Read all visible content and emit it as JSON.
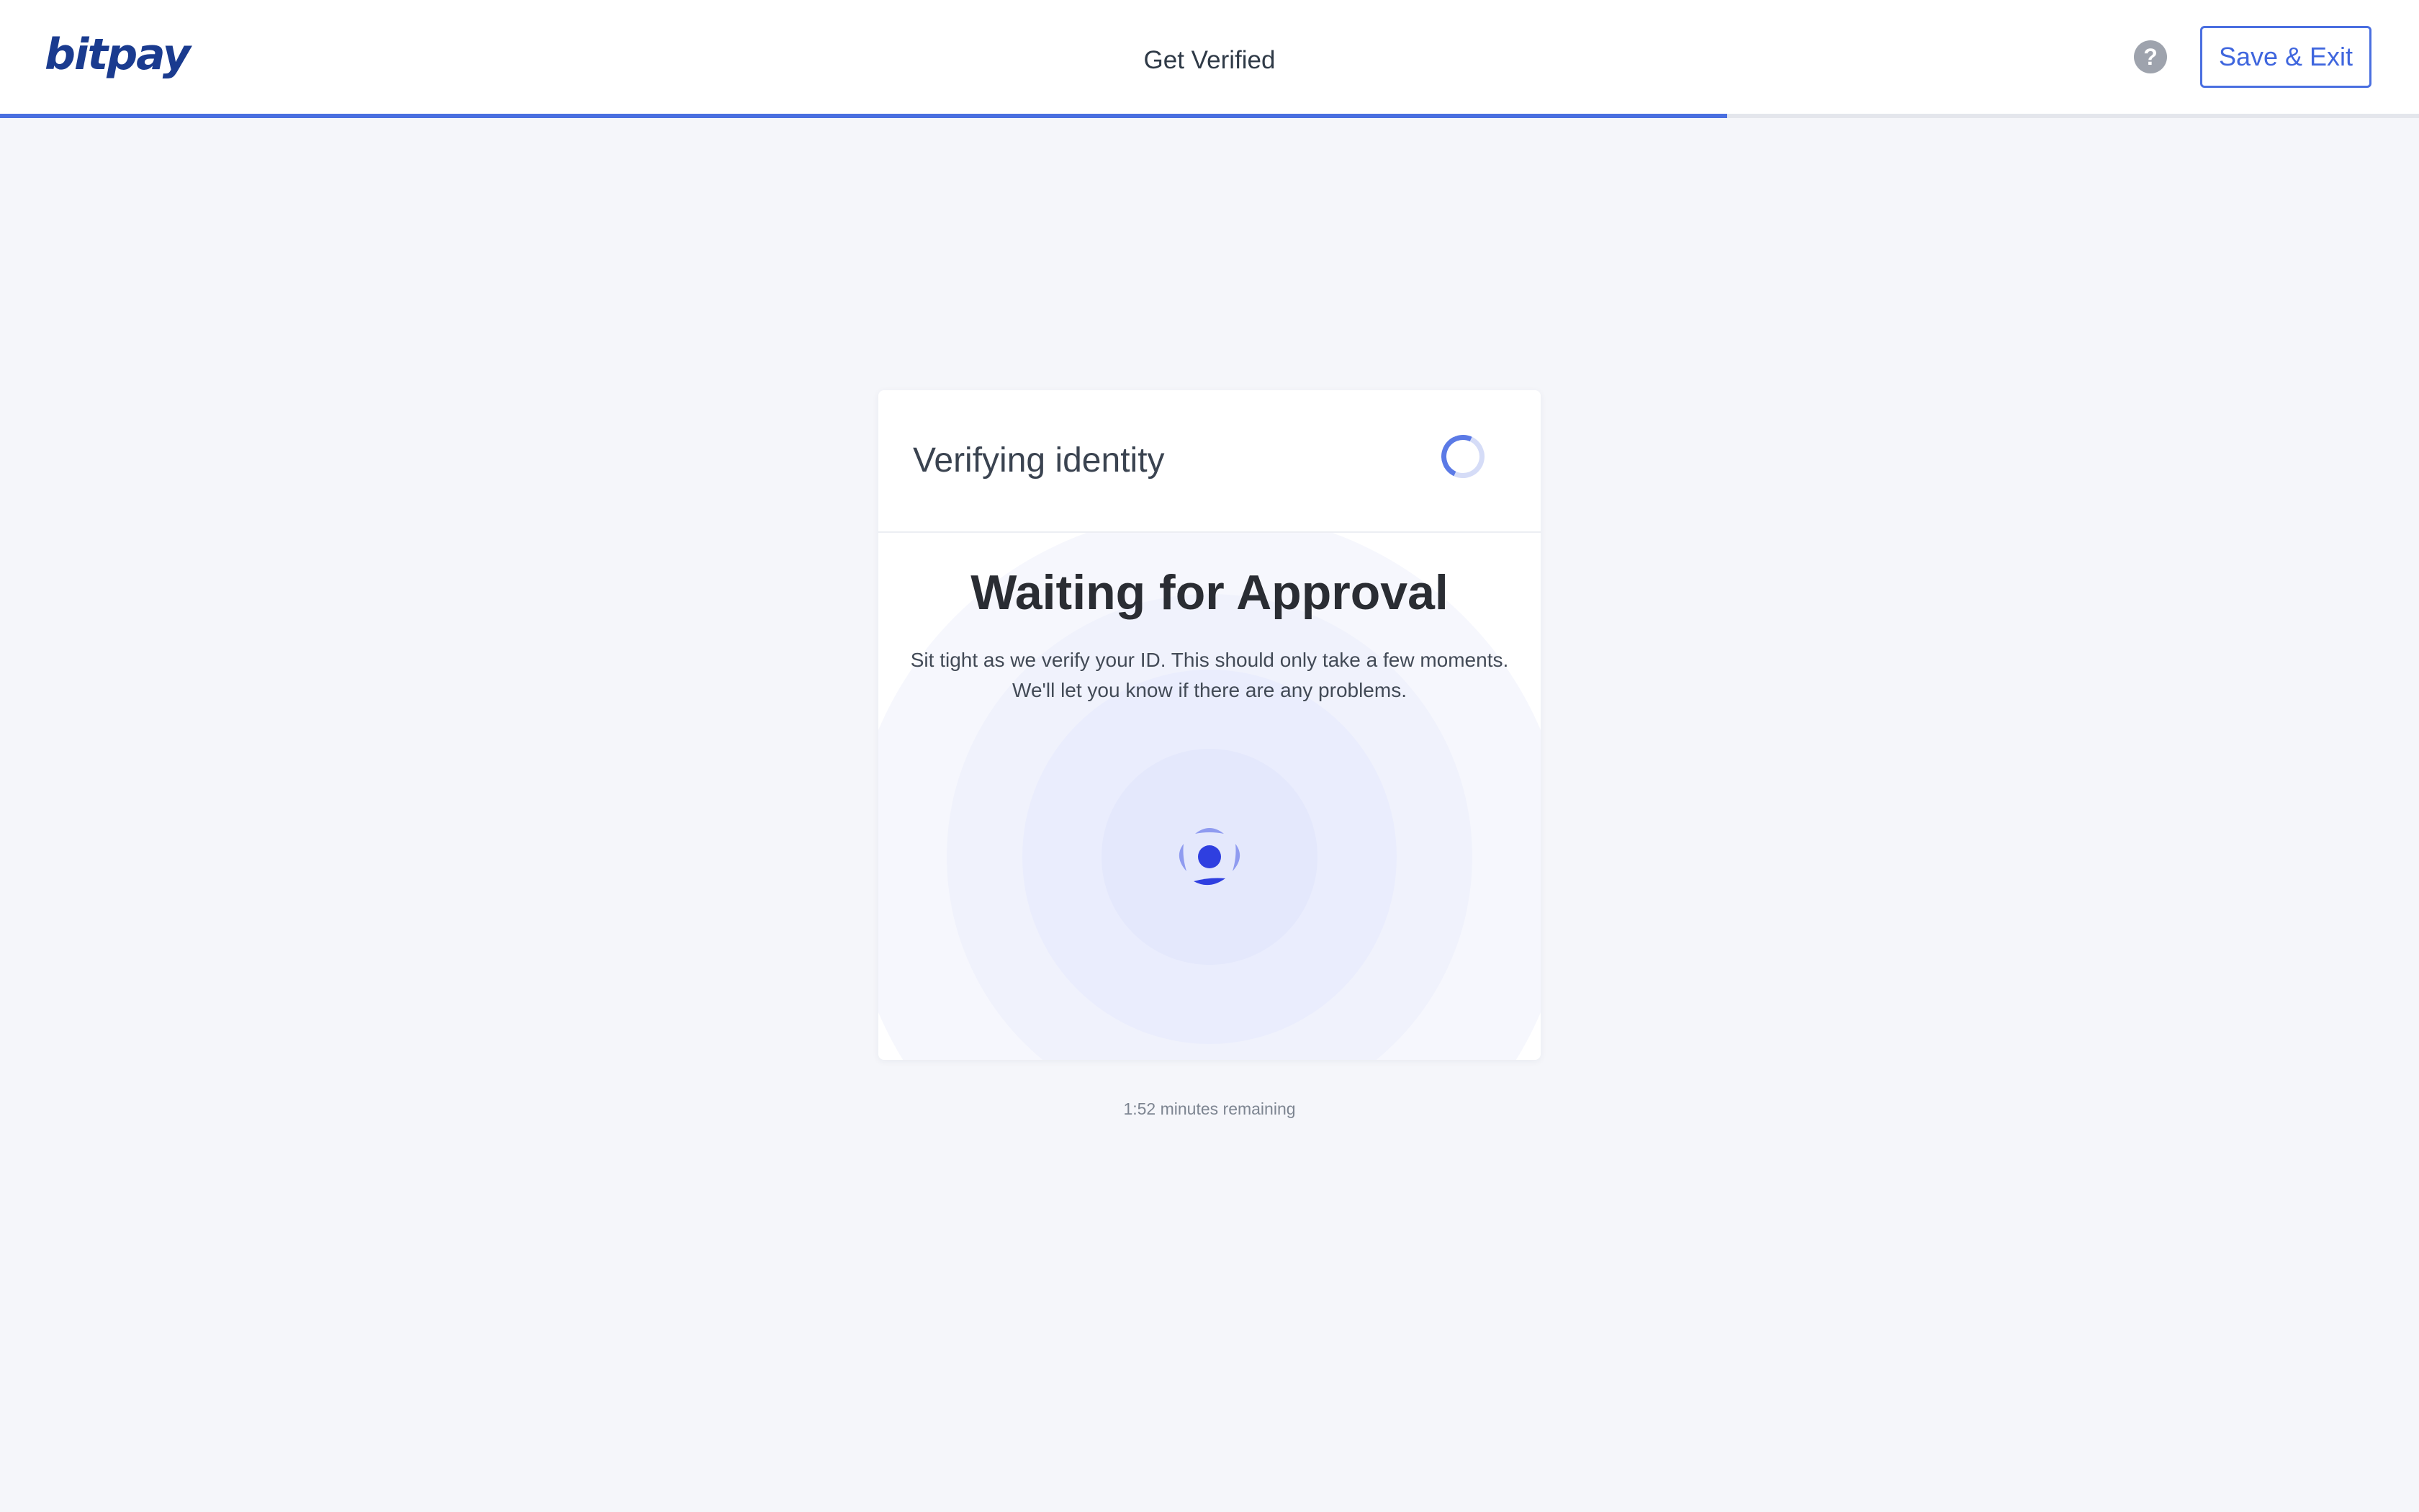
{
  "header": {
    "logo_text": "bitpay",
    "title": "Get Verified",
    "help_icon": "help-circle-icon",
    "help_symbol": "?",
    "save_exit_label": "Save & Exit",
    "progress_fraction": 0.714
  },
  "card": {
    "title": "Verifying identity",
    "status_icon": "loading-spinner-icon",
    "heading": "Waiting for Approval",
    "message_line1": "Sit tight as we verify your ID. This should only take a few moments.",
    "message_line2": "We'll let you know if there are any problems.",
    "center_icon": "identity-scan-icon"
  },
  "footer": {
    "timer_text": "1:52 minutes remaining"
  },
  "colors": {
    "accent": "#4a6fe0",
    "logo": "#1a3b8f",
    "background": "#f5f6fa",
    "icon_primary": "#2f3fe0",
    "icon_secondary": "#8f9bf0"
  }
}
